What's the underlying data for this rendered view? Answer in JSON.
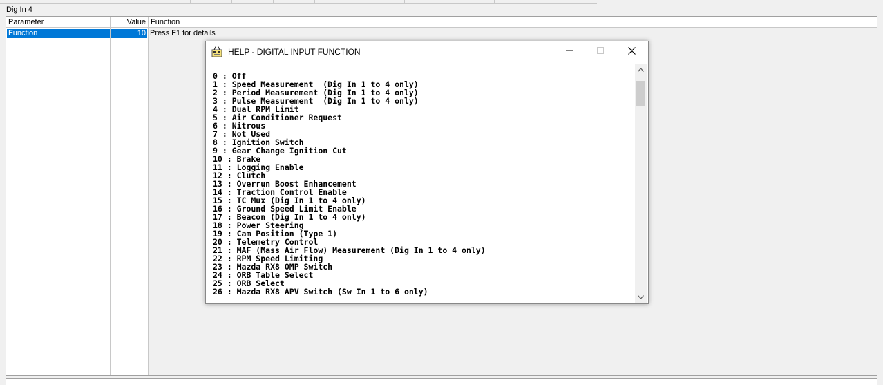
{
  "section": {
    "title": "Dig In 4"
  },
  "table": {
    "headers": {
      "parameter": "Parameter",
      "value": "Value",
      "function": "Function"
    },
    "row": {
      "parameter": "Function",
      "value": "10",
      "function": "Press F1 for details"
    }
  },
  "dialog": {
    "title": "HELP - DIGITAL INPUT FUNCTION",
    "icons": {
      "app": "help-app-icon",
      "minimize": "minimize-icon",
      "maximize": "maximize-icon",
      "close": "close-icon"
    },
    "lines": [
      "0 : Off",
      "1 : Speed Measurement  (Dig In 1 to 4 only)",
      "2 : Period Measurement (Dig In 1 to 4 only)",
      "3 : Pulse Measurement  (Dig In 1 to 4 only)",
      "4 : Dual RPM Limit",
      "5 : Air Conditioner Request",
      "6 : Nitrous",
      "7 : Not Used",
      "8 : Ignition Switch",
      "9 : Gear Change Ignition Cut",
      "10 : Brake",
      "11 : Logging Enable",
      "12 : Clutch",
      "13 : Overrun Boost Enhancement",
      "14 : Traction Control Enable",
      "15 : TC Mux (Dig In 1 to 4 only)",
      "16 : Ground Speed Limit Enable",
      "17 : Beacon (Dig In 1 to 4 only)",
      "18 : Power Steering",
      "19 : Cam Position (Type 1)",
      "20 : Telemetry Control",
      "21 : MAF (Mass Air Flow) Measurement (Dig In 1 to 4 only)",
      "22 : RPM Speed Limiting",
      "23 : Mazda RX8 OMP Switch",
      "24 : ORB Table Select",
      "25 : ORB Select",
      "26 : Mazda RX8 APV Switch (Sw In 1 to 6 only)"
    ]
  },
  "colors": {
    "selection": "#0078d7",
    "background": "#f0f0f0"
  }
}
